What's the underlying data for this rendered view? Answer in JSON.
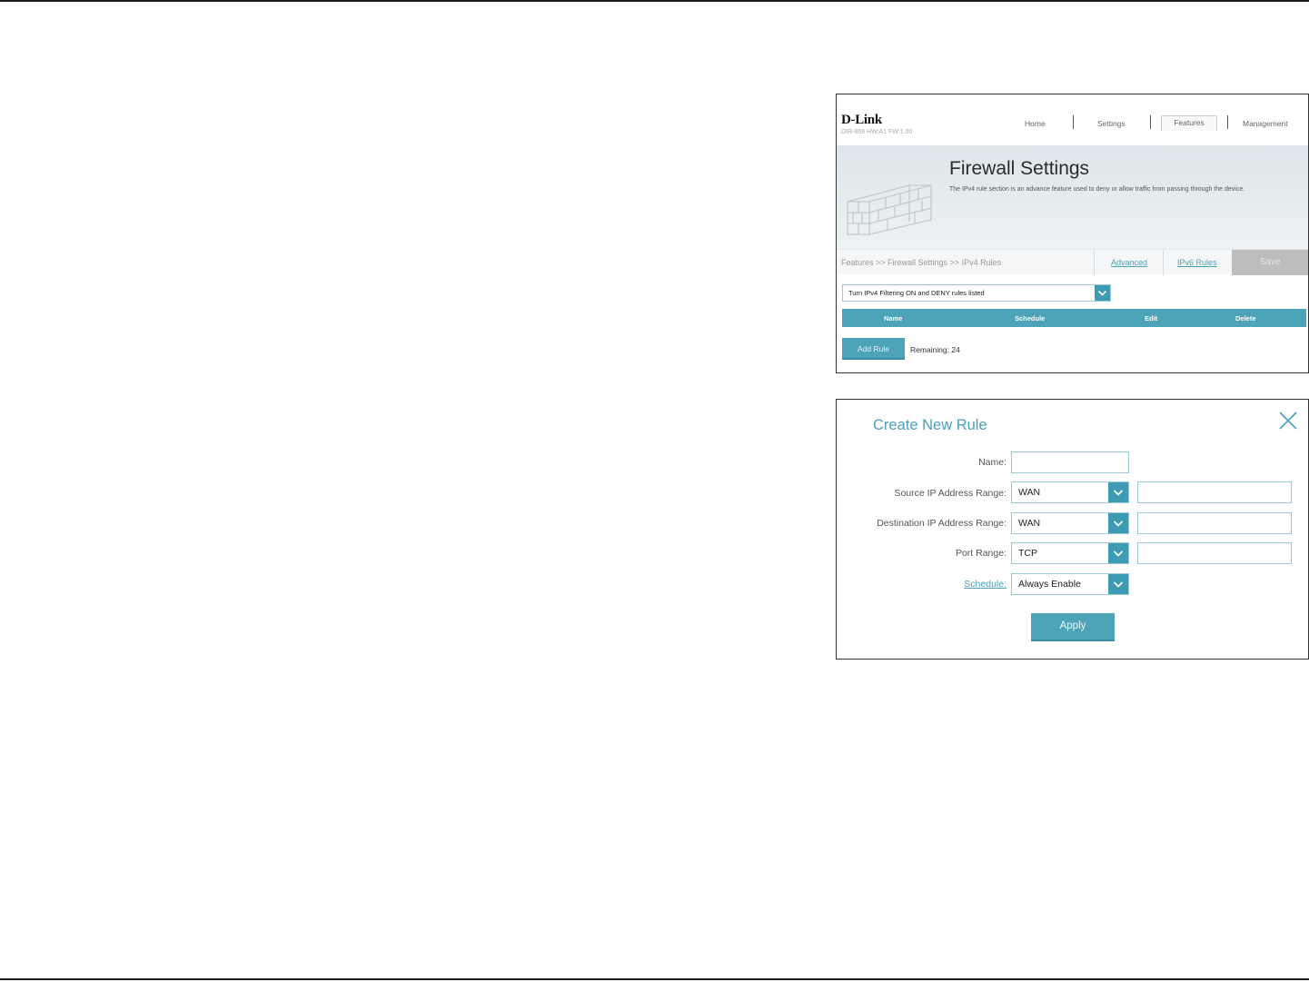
{
  "header": {
    "logo": "D-Link",
    "model": "DIR-869 HW:A1 FW:1.00",
    "nav": [
      {
        "label": "Home",
        "active": false
      },
      {
        "label": "Settings",
        "active": false
      },
      {
        "label": "Features",
        "active": true
      },
      {
        "label": "Management",
        "active": false
      }
    ]
  },
  "banner": {
    "title": "Firewall Settings",
    "description": "The IPv4 rule section is an advance feature used to deny or allow traffic from passing through the device."
  },
  "subnav": {
    "breadcrumb": "Features >> Firewall Settings >> IPv4 Rules",
    "advanced_link": "Advanced",
    "ipv6_link": "IPv6 Rules",
    "save_label": "Save"
  },
  "filter": {
    "selected": "Turn IPv4 Filtering ON and DENY rules listed"
  },
  "rules_table": {
    "columns": [
      "Name",
      "Schedule",
      "Edit",
      "Delete"
    ],
    "rows": []
  },
  "add_rule": {
    "label": "Add Rule",
    "remaining": "Remaining: 24"
  },
  "create_rule": {
    "title": "Create New Rule",
    "name_label": "Name:",
    "name_value": "",
    "source_label": "Source IP Address Range:",
    "source_value": "WAN",
    "source_ip_value": "",
    "dest_label": "Destination IP Address Range:",
    "dest_value": "WAN",
    "dest_ip_value": "",
    "port_label": "Port Range:",
    "port_value": "TCP",
    "port_range_value": "",
    "schedule_label": "Schedule:",
    "schedule_value": "Always Enable",
    "apply_label": "Apply"
  },
  "colors": {
    "accent": "#4da3b8",
    "accent_dark": "#3d9bb3",
    "save_disabled": "#bdbdbd"
  },
  "icons": {
    "wall": "brick-wall-icon",
    "close": "close-icon",
    "dropdown": "chevron-down-icon"
  }
}
